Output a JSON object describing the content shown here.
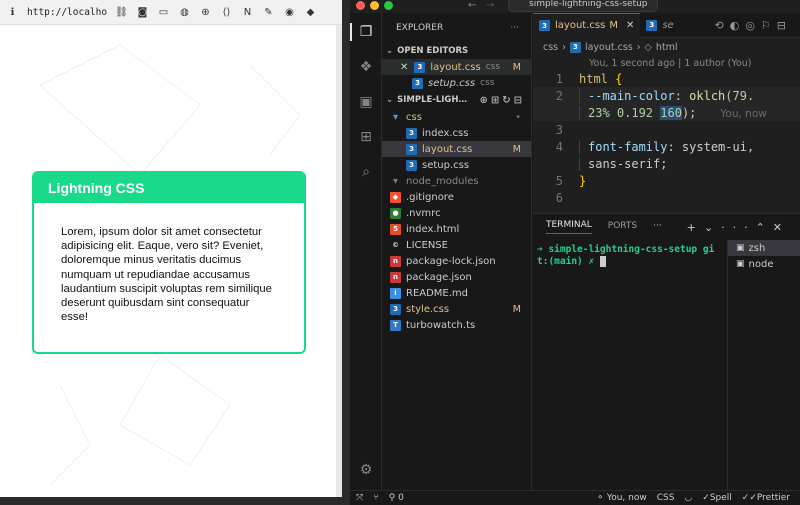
{
  "browser": {
    "url": "http://localhos…",
    "card": {
      "title": "Lightning CSS",
      "body": "Lorem, ipsum dolor sit amet consectetur adipisicing elit. Eaque, vero sit? Eveniet, doloremque minus veritatis ducimus numquam ut repudiandae accusamus laudantium suscipit voluptas rem similique deserunt quibusdam sint consequatur esse!"
    },
    "accent_color": "#19d98b"
  },
  "vscode": {
    "search_title": "simple-lightning-css-setup",
    "explorer": {
      "header": "EXPLORER",
      "open_editors_label": "OPEN EDITORS",
      "open_editors": [
        {
          "name": "layout.css",
          "folder": "css",
          "status": "M",
          "active": true
        },
        {
          "name": "setup.css",
          "folder": "css",
          "status": "",
          "active": false
        }
      ],
      "project_label": "SIMPLE-LIGH…",
      "tree": [
        {
          "name": "css",
          "icon": "folder-icon",
          "status": "•",
          "modified": true
        },
        {
          "name": "index.css",
          "icon": "css-icon",
          "status": "",
          "indent": 1
        },
        {
          "name": "layout.css",
          "icon": "css-icon",
          "status": "M",
          "modified": true,
          "indent": 1,
          "selected": true
        },
        {
          "name": "setup.css",
          "icon": "css-icon",
          "status": "",
          "indent": 1
        },
        {
          "name": "node_modules",
          "icon": "folder-icon",
          "status": "",
          "dim": true
        },
        {
          "name": ".gitignore",
          "icon": "git-icon",
          "status": ""
        },
        {
          "name": ".nvmrc",
          "icon": "node-icon",
          "status": ""
        },
        {
          "name": "index.html",
          "icon": "html-icon",
          "status": ""
        },
        {
          "name": "LICENSE",
          "icon": "license-icon",
          "status": ""
        },
        {
          "name": "package-lock.json",
          "icon": "npm-icon",
          "status": ""
        },
        {
          "name": "package.json",
          "icon": "npm-icon",
          "status": ""
        },
        {
          "name": "README.md",
          "icon": "info-icon",
          "status": ""
        },
        {
          "name": "style.css",
          "icon": "css-icon",
          "status": "M",
          "modified": true
        },
        {
          "name": "turbowatch.ts",
          "icon": "ts-icon",
          "status": ""
        }
      ]
    },
    "tabs": [
      {
        "name": "layout.css",
        "status": "M",
        "active": true
      },
      {
        "name": "se",
        "status": "",
        "active": false
      }
    ],
    "breadcrumb": [
      "css",
      "layout.css",
      "html"
    ],
    "blame": "You, 1 second ago | 1 author (You)",
    "code": {
      "lines": [
        "1",
        "2",
        "",
        "3",
        "4",
        "",
        "5",
        "6"
      ],
      "l1_sel": "html",
      "l1_brace": "{",
      "l2_prop": "--main-color",
      "l2_colon": ": ",
      "l2_fn": "oklch",
      "l2_args1": "(79.",
      "l2b_a": "23% 0.192 ",
      "l2b_hl": "160",
      "l2b_end": ");",
      "inline_blame": "You, now",
      "l4_prop": "font-family",
      "l4_val": ": system-ui,",
      "l4b_val": "sans-serif",
      "l4b_end": ";",
      "l5": "}"
    },
    "panel": {
      "tabs": [
        "TERMINAL",
        "PORTS"
      ],
      "active_tab": "TERMINAL",
      "prompt_line1": "➜  simple-lightning-css-setup gi",
      "prompt_line2": "t:(main) ✗ ",
      "terminals": [
        "zsh",
        "node"
      ]
    },
    "status": {
      "errors": "0",
      "author": "You, now",
      "language": "CSS",
      "spell": "Spell",
      "prettier": "Prettier"
    }
  }
}
